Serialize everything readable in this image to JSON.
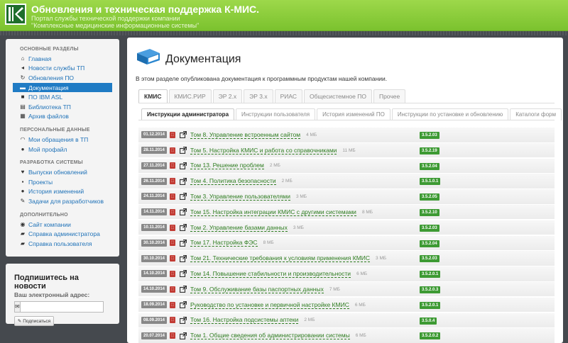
{
  "header": {
    "title": "Обновления и техническая поддержка К-МИС.",
    "subtitle": "Портал службы технической поддержки компании \"Комплексные медицинские информационные системы\""
  },
  "sidebar": {
    "sections": [
      {
        "title": "Основные разделы",
        "items": [
          {
            "label": "Главная",
            "icon": "home-icon"
          },
          {
            "label": "Новости службы ТП",
            "icon": "bullhorn-icon"
          },
          {
            "label": "Обновления ПО",
            "icon": "refresh-icon"
          },
          {
            "label": "Документация",
            "icon": "book-icon",
            "active": true
          },
          {
            "label": "ПО IBM ASL",
            "icon": "box-icon"
          },
          {
            "label": "Библиотека ТП",
            "icon": "library-icon"
          },
          {
            "label": "Архив файлов",
            "icon": "archive-icon"
          }
        ]
      },
      {
        "title": "Персональные данные",
        "items": [
          {
            "label": "Мои обращения в ТП",
            "icon": "headphones-icon"
          },
          {
            "label": "Мой профайл",
            "icon": "user-icon"
          }
        ]
      },
      {
        "title": "Разработка системы",
        "items": [
          {
            "label": "Выпуски обновлений",
            "icon": "heart-icon"
          },
          {
            "label": "Проекты",
            "icon": "projects-icon"
          },
          {
            "label": "История изменений",
            "icon": "info-icon"
          },
          {
            "label": "Задачи для разработчиков",
            "icon": "wrench-icon"
          }
        ]
      },
      {
        "title": "Дополнительно",
        "items": [
          {
            "label": "Сайт компании",
            "icon": "globe-icon"
          },
          {
            "label": "Справка администратора",
            "icon": "folder-icon"
          },
          {
            "label": "Справка пользователя",
            "icon": "folder-icon"
          }
        ]
      }
    ]
  },
  "subscribe": {
    "title": "Подпишитесь на новости",
    "label": "Ваш электронный адрес:",
    "input_value": "",
    "button_label": "Подписаться"
  },
  "main": {
    "title": "Документация",
    "intro": "В этом разделе опубликована документация к программным продуктам нашей компании.",
    "product_tabs": [
      "КМИС",
      "КМИС.РИР",
      "ЭР 2.х",
      "ЭР 3.х",
      "РИАС",
      "Общесистемное ПО",
      "Прочее"
    ],
    "active_product_tab": 0,
    "doc_tabs": [
      "Инструкции администратора",
      "Инструкции пользователя",
      "История изменений ПО",
      "Инструкции по установке и обновлению",
      "Каталоги форм"
    ],
    "active_doc_tab": 0,
    "documents": [
      {
        "date": "01.12.2014",
        "title": "Том 8. Управление встроенным сайтом",
        "size": "4 МБ",
        "version": "3.5.2.03"
      },
      {
        "date": "28.11.2014",
        "title": "Том 5. Настройка КМИС и работа со справочниками",
        "size": "11 МБ",
        "version": "3.5.2.19"
      },
      {
        "date": "27.11.2014",
        "title": "Том 13. Решение проблем",
        "size": "2 МБ",
        "version": "3.5.2.04"
      },
      {
        "date": "26.11.2014",
        "title": "Том 4. Политика безопасности",
        "size": "2 МБ",
        "version": "3.5.1.0.1"
      },
      {
        "date": "24.11.2014",
        "title": "Том 3. Управление пользователями",
        "size": "3 МБ",
        "version": "3.5.2.05"
      },
      {
        "date": "14.11.2014",
        "title": "Том 15. Настройка интеграции КМИС с другими системами",
        "size": "8 МБ",
        "version": "3.5.2.10"
      },
      {
        "date": "10.11.2014",
        "title": "Том 2. Управление базами данных",
        "size": "3 МБ",
        "version": "3.5.2.03"
      },
      {
        "date": "30.10.2014",
        "title": "Том 17. Настройка ФЭС",
        "size": "8 МБ",
        "version": "3.5.2.04"
      },
      {
        "date": "30.10.2014",
        "title": "Том 21. Технические требования к условиям применения КМИС",
        "size": "3 МБ",
        "version": "3.5.2.03"
      },
      {
        "date": "14.10.2014",
        "title": "Том 14. Повышение стабильности и производительности",
        "size": "6 МБ",
        "version": "3.5.2.0.1"
      },
      {
        "date": "14.10.2014",
        "title": "Том 9. Обслуживание базы паспортных данных",
        "size": "7 МБ",
        "version": "3.5.2.0.3"
      },
      {
        "date": "18.09.2014",
        "title": "Руководство по установке и первичной настройке КМИС",
        "size": "6 МБ",
        "version": "3.5.2.0.1"
      },
      {
        "date": "08.09.2014",
        "title": "Том 16. Настройка подсистемы аптеки",
        "size": "2 МБ",
        "version": "3.5.0.4"
      },
      {
        "date": "20.07.2014",
        "title": "Том 1. Общие сведения об администрировании системы",
        "size": "6 МБ",
        "version": "3.5.2.0.2"
      }
    ]
  },
  "colors": {
    "header_green": "#7bc22e",
    "link_blue": "#1f72b8",
    "active_blue": "#1f7bc4",
    "doc_link_green": "#2e7d20",
    "version_green": "#3d9a33",
    "date_gray": "#888888",
    "pdf_red": "#c23b34"
  }
}
